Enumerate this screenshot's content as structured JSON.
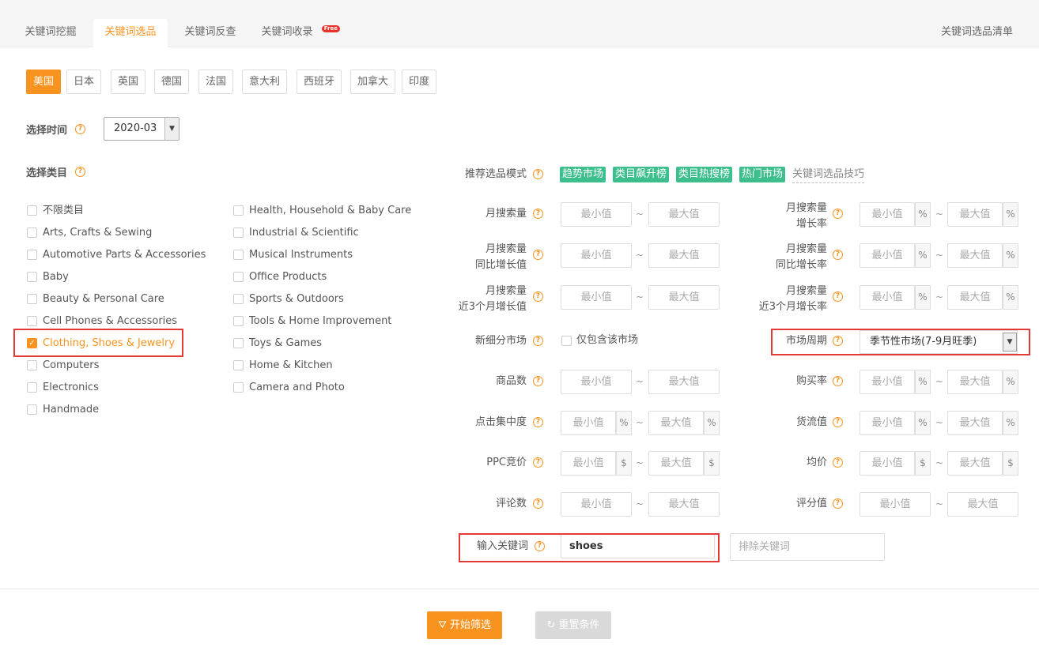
{
  "tabs": [
    {
      "label": "关键词挖掘"
    },
    {
      "label": "关键词选品"
    },
    {
      "label": "关键词反查"
    },
    {
      "label": "关键词收录",
      "badge": "Free"
    }
  ],
  "tab_right": "关键词选品清单",
  "countries": [
    "美国",
    "日本",
    "英国",
    "德国",
    "法国",
    "意大利",
    "西班牙",
    "加拿大",
    "印度"
  ],
  "time": {
    "label": "选择时间",
    "value": "2020-03"
  },
  "category": {
    "label": "选择类目",
    "col1": [
      "不限类目",
      "Arts, Crafts & Sewing",
      "Automotive Parts & Accessories",
      "Baby",
      "Beauty & Personal Care",
      "Cell Phones & Accessories",
      "Clothing, Shoes & Jewelry",
      "Computers",
      "Electronics",
      "Handmade"
    ],
    "col2": [
      "Health, Household & Baby Care",
      "Industrial & Scientific",
      "Musical Instruments",
      "Office Products",
      "Sports & Outdoors",
      "Tools & Home Improvement",
      "Toys & Games",
      "Home & Kitchen",
      "Camera and Photo"
    ],
    "selected": "Clothing, Shoes & Jewelry"
  },
  "modes": {
    "label": "推荐选品模式",
    "tags": [
      "趋势市场",
      "类目飙升榜",
      "类目热搜榜",
      "热门市场"
    ],
    "link": "关键词选品技巧"
  },
  "placeholders": {
    "min": "最小值",
    "max": "最大值",
    "tilde": "~",
    "pct": "%",
    "dollar": "$"
  },
  "filters": {
    "monthly_search": "月搜索量",
    "monthly_growth": [
      "月搜索量",
      "增长率"
    ],
    "yoy_value": [
      "月搜索量",
      "同比增长值"
    ],
    "yoy_rate": [
      "月搜索量",
      "同比增长率"
    ],
    "q3_value": [
      "月搜索量",
      "近3个月增长值"
    ],
    "q3_rate": [
      "月搜索量",
      "近3个月增长率"
    ],
    "new_market": "新细分市场",
    "new_market_option": "仅包含该市场",
    "market_cycle": "市场周期",
    "market_cycle_value": "季节性市场(7-9月旺季)",
    "product_count": "商品数",
    "purchase_rate": "购买率",
    "click_concentration": "点击集中度",
    "gmv": "货流值",
    "ppc": "PPC竞价",
    "avg_price": "均价",
    "reviews": "评论数",
    "rating": "评分值",
    "keyword_label": "输入关键词",
    "keyword_value": "shoes",
    "exclude_placeholder": "排除关键词"
  },
  "buttons": {
    "start": "开始筛选",
    "reset": "重置条件"
  }
}
